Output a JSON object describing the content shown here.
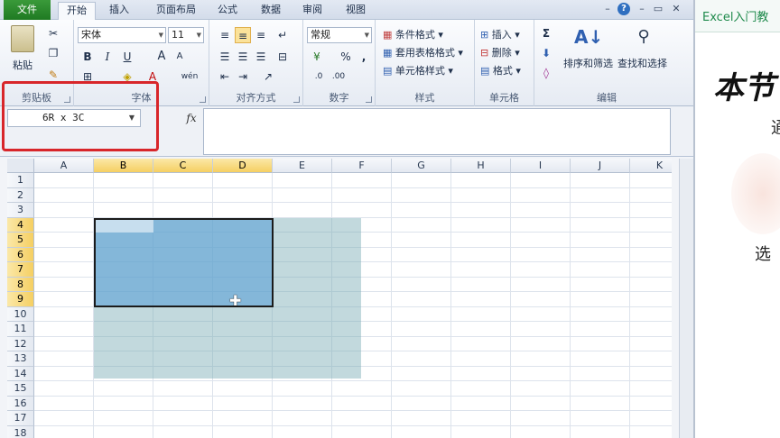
{
  "tabs": [
    {
      "label": "文件"
    },
    {
      "label": "开始"
    },
    {
      "label": "插入"
    },
    {
      "label": "页面布局"
    },
    {
      "label": "公式"
    },
    {
      "label": "数据"
    },
    {
      "label": "审阅"
    },
    {
      "label": "视图"
    }
  ],
  "window_controls": {
    "minimize": "–",
    "restore": "▭",
    "close": "✕",
    "help": "?"
  },
  "ribbon": {
    "clipboard": {
      "paste_label": "粘贴",
      "group_label": "剪贴板"
    },
    "font": {
      "font_name": "宋体",
      "font_size": "11",
      "group_label": "字体",
      "bold": "B",
      "italic": "I",
      "underline": "U",
      "grow": "A",
      "shrink": "A",
      "font_color": "A",
      "wen": "wén"
    },
    "alignment": {
      "group_label": "对齐方式"
    },
    "number": {
      "format": "常规",
      "group_label": "数字",
      "percent": "%",
      "comma": ","
    },
    "styles": {
      "conditional": "条件格式",
      "table_format": "套用表格格式",
      "cell_style": "单元格样式",
      "group_label": "样式"
    },
    "cells": {
      "insert": "插入",
      "delete": "删除",
      "format": "格式",
      "group_label": "单元格"
    },
    "editing": {
      "sort_filter": "排序和筛选",
      "find_select": "查找和选择",
      "group_label": "编辑",
      "sigma": "Σ"
    }
  },
  "formula_bar": {
    "name_box": "6R x 3C",
    "fx": "fx",
    "value": ""
  },
  "grid": {
    "columns": [
      "A",
      "B",
      "C",
      "D",
      "E",
      "F",
      "G",
      "H",
      "I",
      "J",
      "K"
    ],
    "rows": [
      "1",
      "2",
      "3",
      "4",
      "5",
      "6",
      "7",
      "8",
      "9",
      "10",
      "11",
      "12",
      "13",
      "14",
      "15",
      "16",
      "17",
      "18"
    ],
    "highlight_columns": [
      "B",
      "C",
      "D"
    ],
    "highlight_rows": [
      "4",
      "5",
      "6",
      "7",
      "8",
      "9"
    ],
    "selection_color": "#5aa0d7",
    "shade_color": "#78aab4"
  },
  "slide": {
    "title": "Excel入门教",
    "big_text": "本节",
    "char1": "通",
    "char2": "选"
  },
  "colors": {
    "file_tab": "#1f7a22",
    "annotation_red": "#d8262a"
  }
}
